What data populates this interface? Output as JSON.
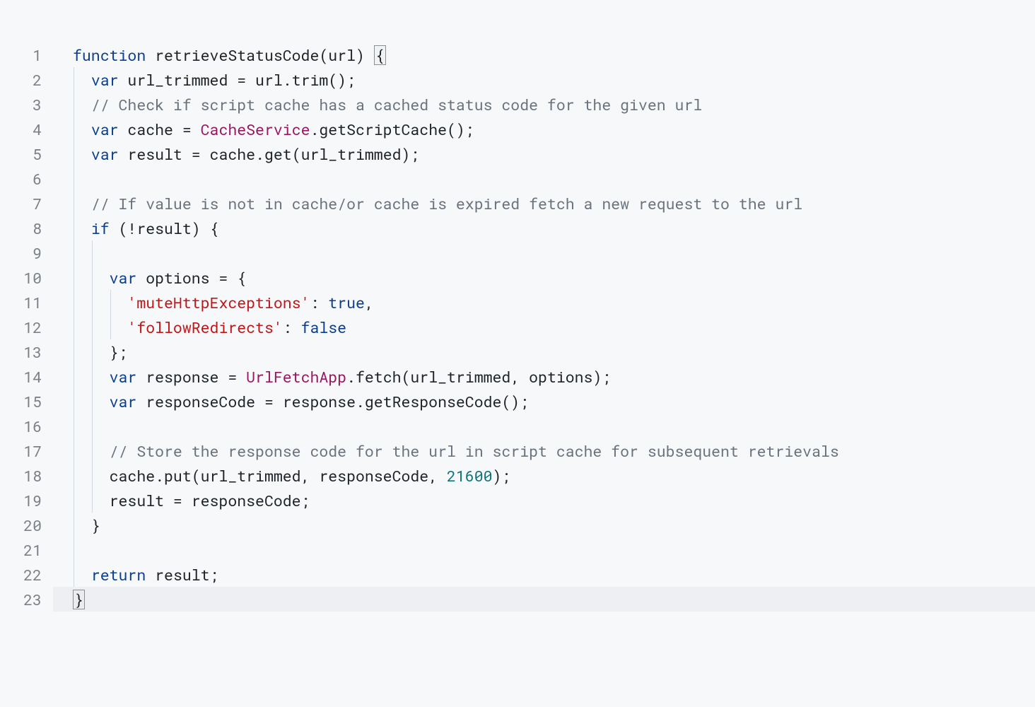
{
  "code": {
    "line_count": 23,
    "colors": {
      "keyword": "#0b3e8e",
      "class": "#9b1661",
      "comment": "#6a737d",
      "string": "#c01618",
      "boolean": "#0b3e8e",
      "number": "#0d7378",
      "default": "#1f2328",
      "gutter": "#7d8186",
      "bg": "#f6f8fa"
    },
    "lines": [
      {
        "n": 1,
        "indent": 0,
        "tokens": [
          {
            "t": "function ",
            "c": "kw"
          },
          {
            "t": "retrieveStatusCode",
            "c": "def"
          },
          {
            "t": "(url) ",
            "c": "pn"
          },
          {
            "t": "{",
            "c": "pn",
            "box": true
          }
        ]
      },
      {
        "n": 2,
        "indent": 1,
        "tokens": [
          {
            "t": "var ",
            "c": "kw"
          },
          {
            "t": "url_trimmed = url.",
            "c": "def"
          },
          {
            "t": "trim",
            "c": "mthd"
          },
          {
            "t": "();",
            "c": "pn"
          }
        ]
      },
      {
        "n": 3,
        "indent": 1,
        "tokens": [
          {
            "t": "// Check if script cache has a cached status code for the given url",
            "c": "cmt"
          }
        ]
      },
      {
        "n": 4,
        "indent": 1,
        "tokens": [
          {
            "t": "var ",
            "c": "kw"
          },
          {
            "t": "cache = ",
            "c": "def"
          },
          {
            "t": "CacheService",
            "c": "cls"
          },
          {
            "t": ".getScriptCache();",
            "c": "pn"
          }
        ]
      },
      {
        "n": 5,
        "indent": 1,
        "tokens": [
          {
            "t": "var ",
            "c": "kw"
          },
          {
            "t": "result = cache.",
            "c": "def"
          },
          {
            "t": "get",
            "c": "mthd"
          },
          {
            "t": "(url_trimmed);",
            "c": "pn"
          }
        ]
      },
      {
        "n": 6,
        "indent": 0,
        "tokens": []
      },
      {
        "n": 7,
        "indent": 1,
        "tokens": [
          {
            "t": "// If value is not in cache/or cache is expired fetch a new request to the url",
            "c": "cmt"
          }
        ]
      },
      {
        "n": 8,
        "indent": 1,
        "tokens": [
          {
            "t": "if ",
            "c": "kw"
          },
          {
            "t": "(!result) {",
            "c": "pn"
          }
        ]
      },
      {
        "n": 9,
        "indent": 0,
        "tokens": []
      },
      {
        "n": 10,
        "indent": 2,
        "tokens": [
          {
            "t": "var ",
            "c": "kw"
          },
          {
            "t": "options = {",
            "c": "def"
          }
        ]
      },
      {
        "n": 11,
        "indent": 3,
        "tokens": [
          {
            "t": "'muteHttpExceptions'",
            "c": "str"
          },
          {
            "t": ": ",
            "c": "pn"
          },
          {
            "t": "true",
            "c": "boolv"
          },
          {
            "t": ",",
            "c": "pn"
          }
        ]
      },
      {
        "n": 12,
        "indent": 3,
        "tokens": [
          {
            "t": "'followRedirects'",
            "c": "str"
          },
          {
            "t": ": ",
            "c": "pn"
          },
          {
            "t": "false",
            "c": "boolv"
          }
        ]
      },
      {
        "n": 13,
        "indent": 2,
        "tokens": [
          {
            "t": "};",
            "c": "pn"
          }
        ]
      },
      {
        "n": 14,
        "indent": 2,
        "tokens": [
          {
            "t": "var ",
            "c": "kw"
          },
          {
            "t": "response = ",
            "c": "def"
          },
          {
            "t": "UrlFetchApp",
            "c": "cls"
          },
          {
            "t": ".fetch(url_trimmed, options);",
            "c": "pn"
          }
        ]
      },
      {
        "n": 15,
        "indent": 2,
        "tokens": [
          {
            "t": "var ",
            "c": "kw"
          },
          {
            "t": "responseCode = response.getResponseCode();",
            "c": "def"
          }
        ]
      },
      {
        "n": 16,
        "indent": 0,
        "tokens": []
      },
      {
        "n": 17,
        "indent": 2,
        "tokens": [
          {
            "t": "// Store the response code for the url in script cache for subsequent retrievals",
            "c": "cmt"
          }
        ]
      },
      {
        "n": 18,
        "indent": 2,
        "tokens": [
          {
            "t": "cache.put(url_trimmed, responseCode, ",
            "c": "def"
          },
          {
            "t": "21600",
            "c": "num"
          },
          {
            "t": ");",
            "c": "pn"
          }
        ]
      },
      {
        "n": 19,
        "indent": 2,
        "tokens": [
          {
            "t": "result = responseCode;",
            "c": "def"
          }
        ]
      },
      {
        "n": 20,
        "indent": 1,
        "tokens": [
          {
            "t": "}",
            "c": "pn"
          }
        ]
      },
      {
        "n": 21,
        "indent": 0,
        "tokens": []
      },
      {
        "n": 22,
        "indent": 1,
        "tokens": [
          {
            "t": "return ",
            "c": "kw"
          },
          {
            "t": "result;",
            "c": "def"
          }
        ]
      },
      {
        "n": 23,
        "indent": 0,
        "hl": true,
        "tokens": [
          {
            "t": "}",
            "c": "pn",
            "box": true
          }
        ]
      }
    ]
  }
}
